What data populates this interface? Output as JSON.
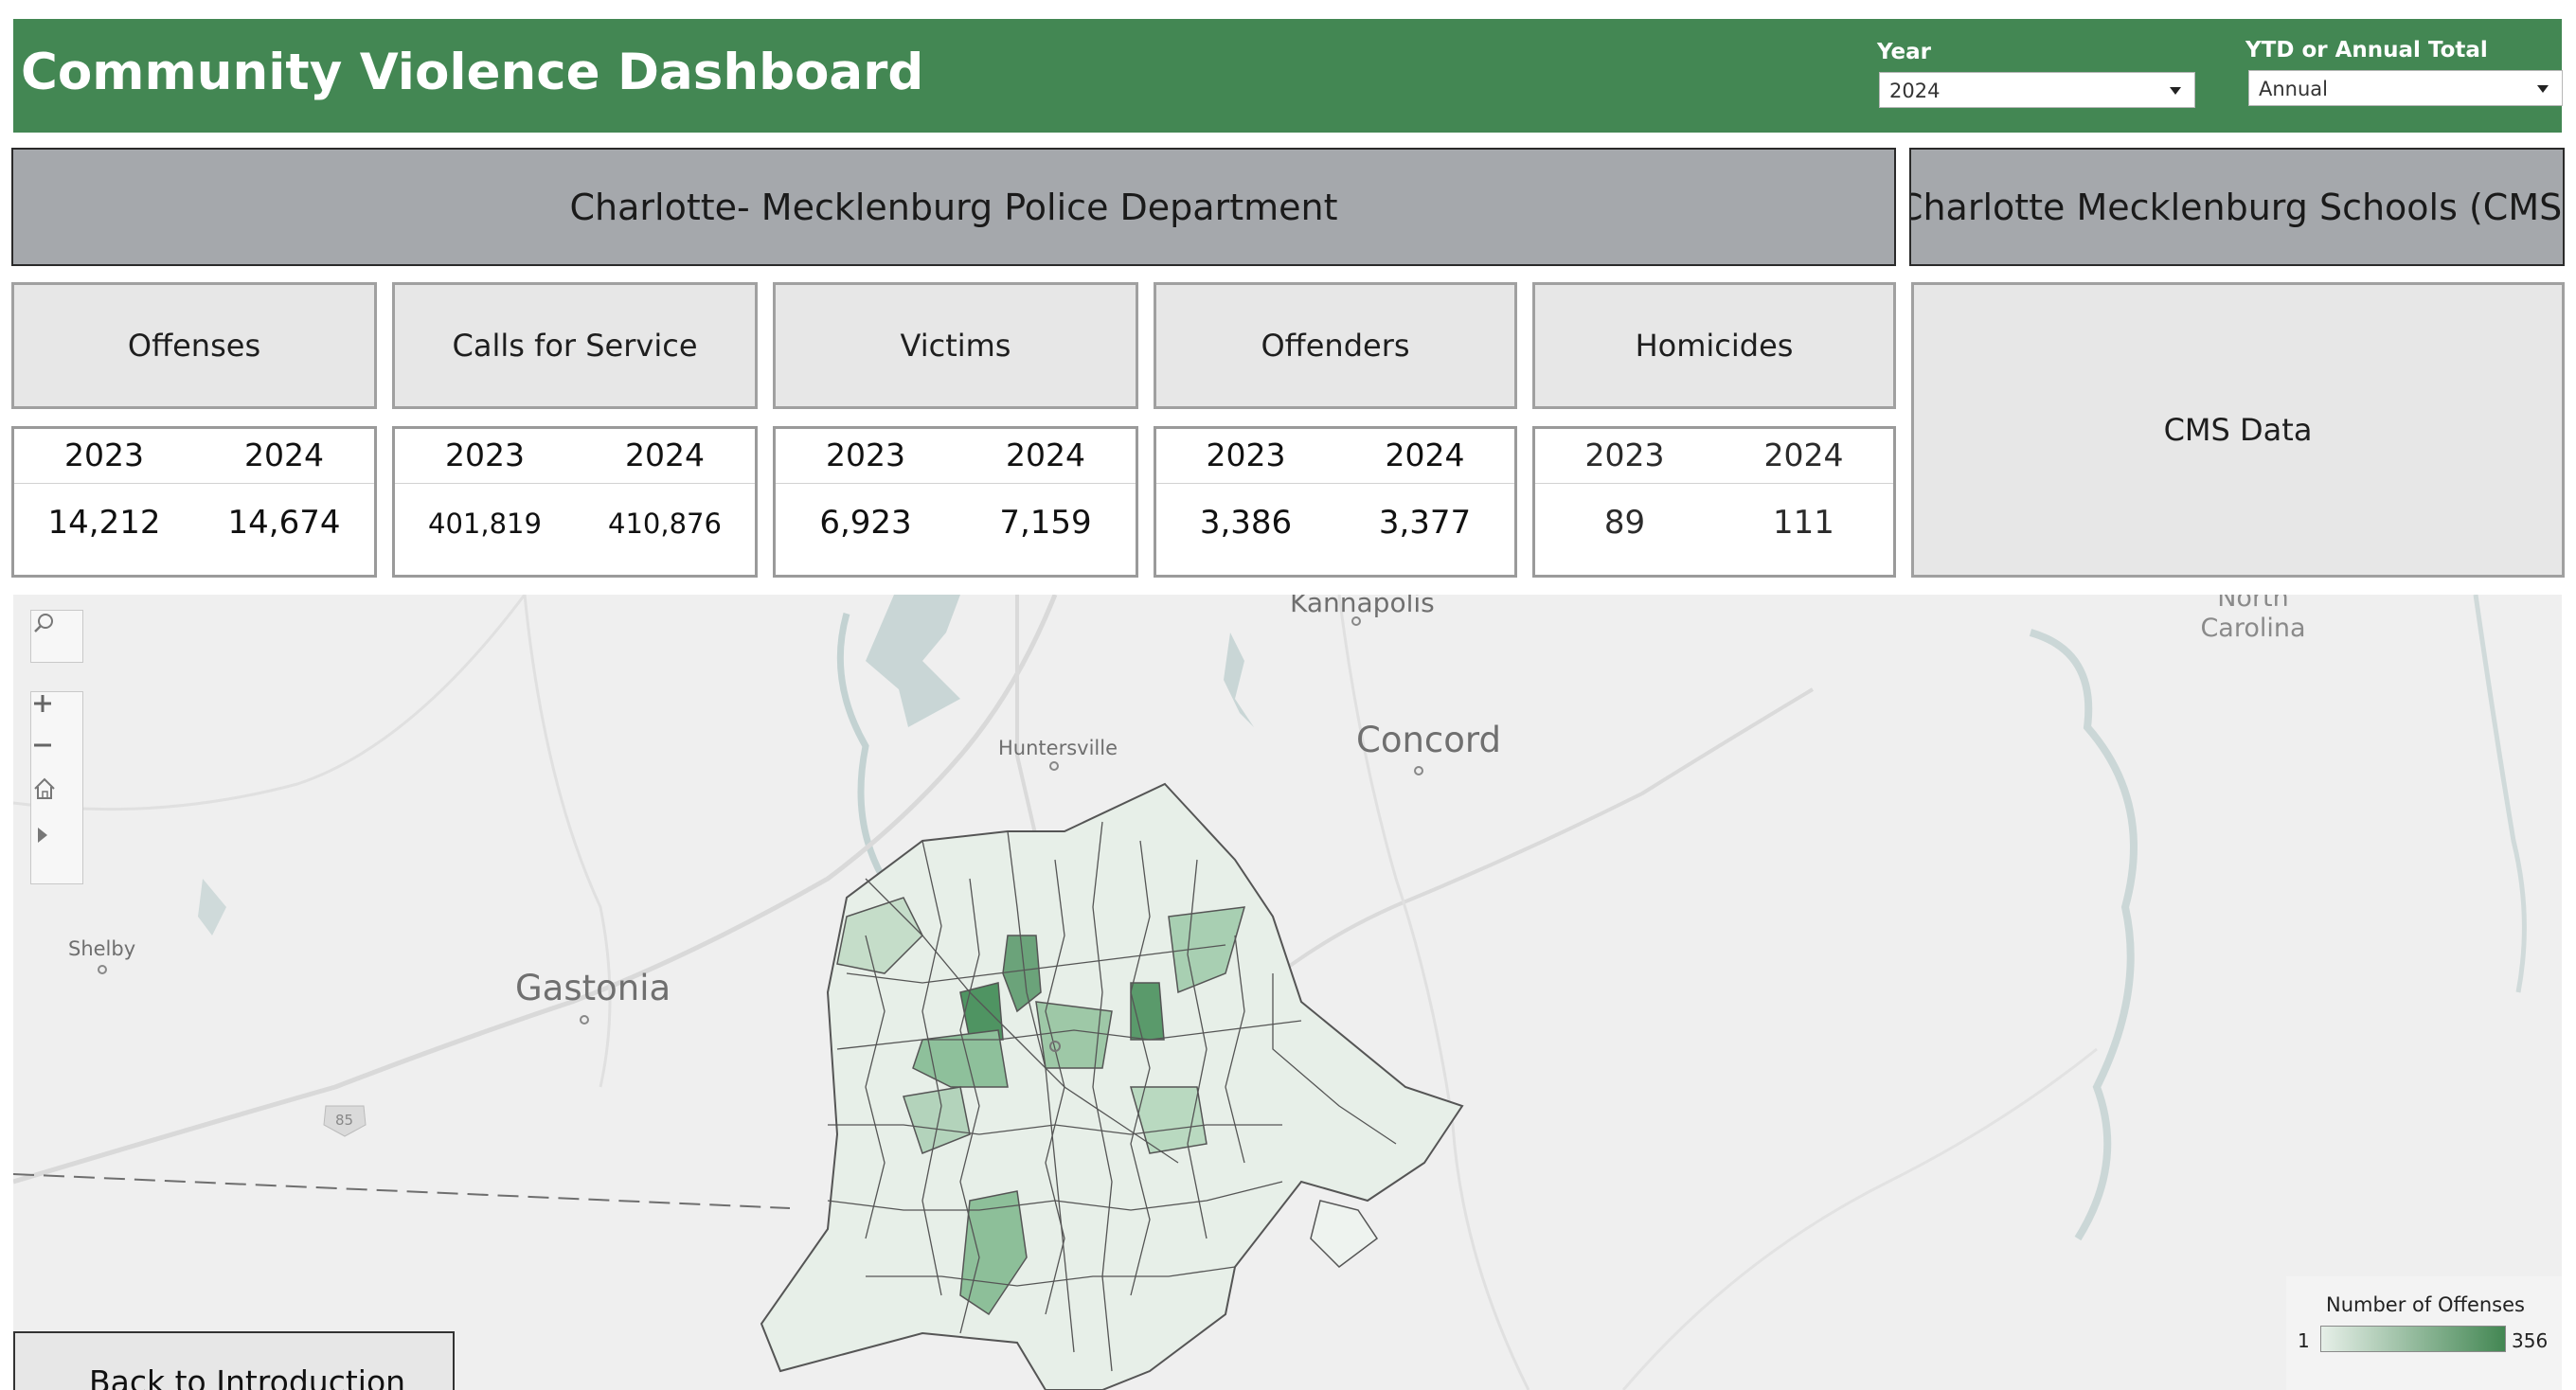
{
  "header": {
    "title": "Community Violence Dashboard",
    "filters": {
      "year": {
        "label": "Year",
        "value": "2024"
      },
      "period": {
        "label": "YTD or Annual Total",
        "value": "Annual"
      }
    }
  },
  "sections": {
    "cmpd": "Charlotte- Mecklenburg Police Department",
    "cms": "Charlotte Mecklenburg Schools (CMS)"
  },
  "metrics": [
    {
      "label": "Offenses",
      "years": [
        "2023",
        "2024"
      ],
      "values": [
        "14,212",
        "14,674"
      ]
    },
    {
      "label": "Calls for Service",
      "years": [
        "2023",
        "2024"
      ],
      "values": [
        "401,819",
        "410,876"
      ]
    },
    {
      "label": "Victims",
      "years": [
        "2023",
        "2024"
      ],
      "values": [
        "6,923",
        "7,159"
      ]
    },
    {
      "label": "Offenders",
      "years": [
        "2023",
        "2024"
      ],
      "values": [
        "3,386",
        "3,377"
      ]
    },
    {
      "label": "Homicides",
      "years": [
        "2023",
        "2024"
      ],
      "values": [
        "89",
        "111"
      ]
    }
  ],
  "cms_data_label": "CMS Data",
  "map": {
    "places": {
      "kannapolis": "Kannapolis",
      "north_carolina": "North Carolina",
      "huntersville": "Huntersville",
      "concord": "Concord",
      "shelby": "Shelby",
      "gastonia": "Gastonia",
      "interstate": "85"
    },
    "icons": {
      "search": "search-icon",
      "zoom_in": "zoom-in-icon",
      "zoom_out": "zoom-out-icon",
      "home": "home-icon",
      "expand": "play-icon"
    },
    "legend": {
      "title": "Number of Offenses",
      "min": "1",
      "max": "356",
      "color_low": "#e6efe8",
      "color_high": "#438753"
    }
  },
  "back_button": "Back to Introduction",
  "colors": {
    "header_green": "#438753",
    "banner_gray": "#a5a8ac",
    "tile_gray": "#e7e7e7"
  }
}
